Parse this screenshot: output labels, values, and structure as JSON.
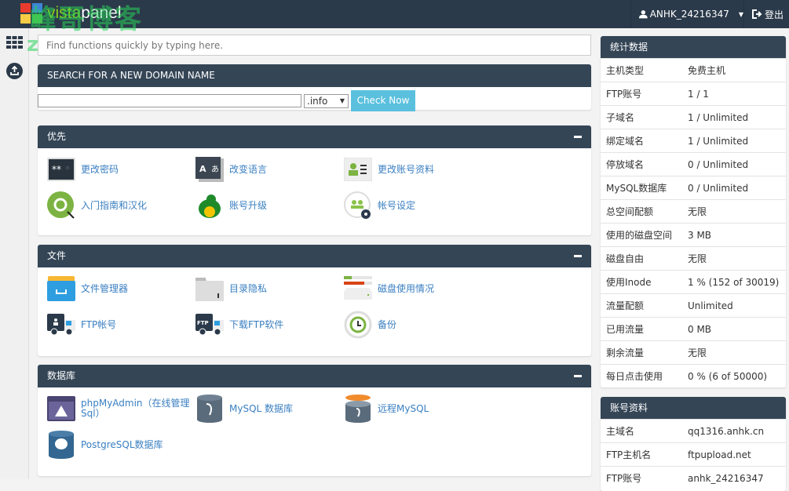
{
  "header": {
    "brand_a": "vista",
    "brand_b": "panel",
    "username": "ANHK_24216347",
    "logout": "登出"
  },
  "watermark": {
    "line1": "峰哥博客",
    "line2": "zzzzzz.me"
  },
  "sidebar": {
    "items": [
      {
        "icon": "grid-icon"
      },
      {
        "icon": "upload-icon"
      }
    ]
  },
  "search": {
    "placeholder": "Find functions quickly by typing here."
  },
  "domain": {
    "title": "SEARCH FOR A NEW DOMAIN NAME",
    "value": "",
    "tld": ".info",
    "button": "Check Now"
  },
  "sections": [
    {
      "title": "优先",
      "items": [
        {
          "label": "更改密码",
          "icon": "password-icon"
        },
        {
          "label": "改变语言",
          "icon": "language-icon"
        },
        {
          "label": "更改账号资料",
          "icon": "profile-card-icon"
        },
        {
          "label": "入门指南和汉化",
          "icon": "getting-started-icon"
        },
        {
          "label": "账号升级",
          "icon": "dragon-upgrade-icon"
        },
        {
          "label": "帐号设定",
          "icon": "account-settings-icon"
        }
      ]
    },
    {
      "title": "文件",
      "items": [
        {
          "label": "文件管理器",
          "icon": "file-manager-icon"
        },
        {
          "label": "目录隐私",
          "icon": "folder-lock-icon"
        },
        {
          "label": "磁盘使用情况",
          "icon": "disk-usage-icon"
        },
        {
          "label": "FTP帐号",
          "icon": "ftp-truck-icon"
        },
        {
          "label": "下载FTP软件",
          "icon": "ftp-download-truck-icon"
        },
        {
          "label": "备份",
          "icon": "backup-icon"
        }
      ]
    },
    {
      "title": "数据库",
      "items": [
        {
          "label": "phpMyAdmin（在线管理Sql）",
          "icon": "phpmyadmin-icon"
        },
        {
          "label": "MySQL 数据库",
          "icon": "mysql-database-icon"
        },
        {
          "label": "远程MySQL",
          "icon": "remote-mysql-icon"
        },
        {
          "label": "PostgreSQL数据库",
          "icon": "postgresql-icon"
        }
      ]
    }
  ],
  "stats": {
    "title": "统计数据",
    "rows": [
      [
        "主机类型",
        "免费主机"
      ],
      [
        "FTP账号",
        "1 / 1"
      ],
      [
        "子域名",
        "1 / Unlimited"
      ],
      [
        "绑定域名",
        "1 / Unlimited"
      ],
      [
        "停放域名",
        "0 / Unlimited"
      ],
      [
        "MySQL数据库",
        "0 / Unlimited"
      ],
      [
        "总空间配额",
        "无限"
      ],
      [
        "使用的磁盘空间",
        "3 MB"
      ],
      [
        "磁盘自由",
        "无限"
      ],
      [
        "使用Inode",
        "1 % (152 of 30019)"
      ],
      [
        "流量配额",
        "Unlimited"
      ],
      [
        "已用流量",
        "0 MB"
      ],
      [
        "剩余流量",
        "无限"
      ],
      [
        "每日点击使用",
        "0 % (6 of 50000)"
      ]
    ]
  },
  "account": {
    "title": "账号资料",
    "rows": [
      [
        "主域名",
        "qq1316.anhk.cn"
      ],
      [
        "FTP主机名",
        "ftpupload.net"
      ],
      [
        "FTP账号",
        "anhk_24216347"
      ]
    ]
  },
  "colors": {
    "header": "#2b3a4a",
    "panel_header": "#344556",
    "link": "#3a7fc1",
    "button": "#5bc0de"
  }
}
